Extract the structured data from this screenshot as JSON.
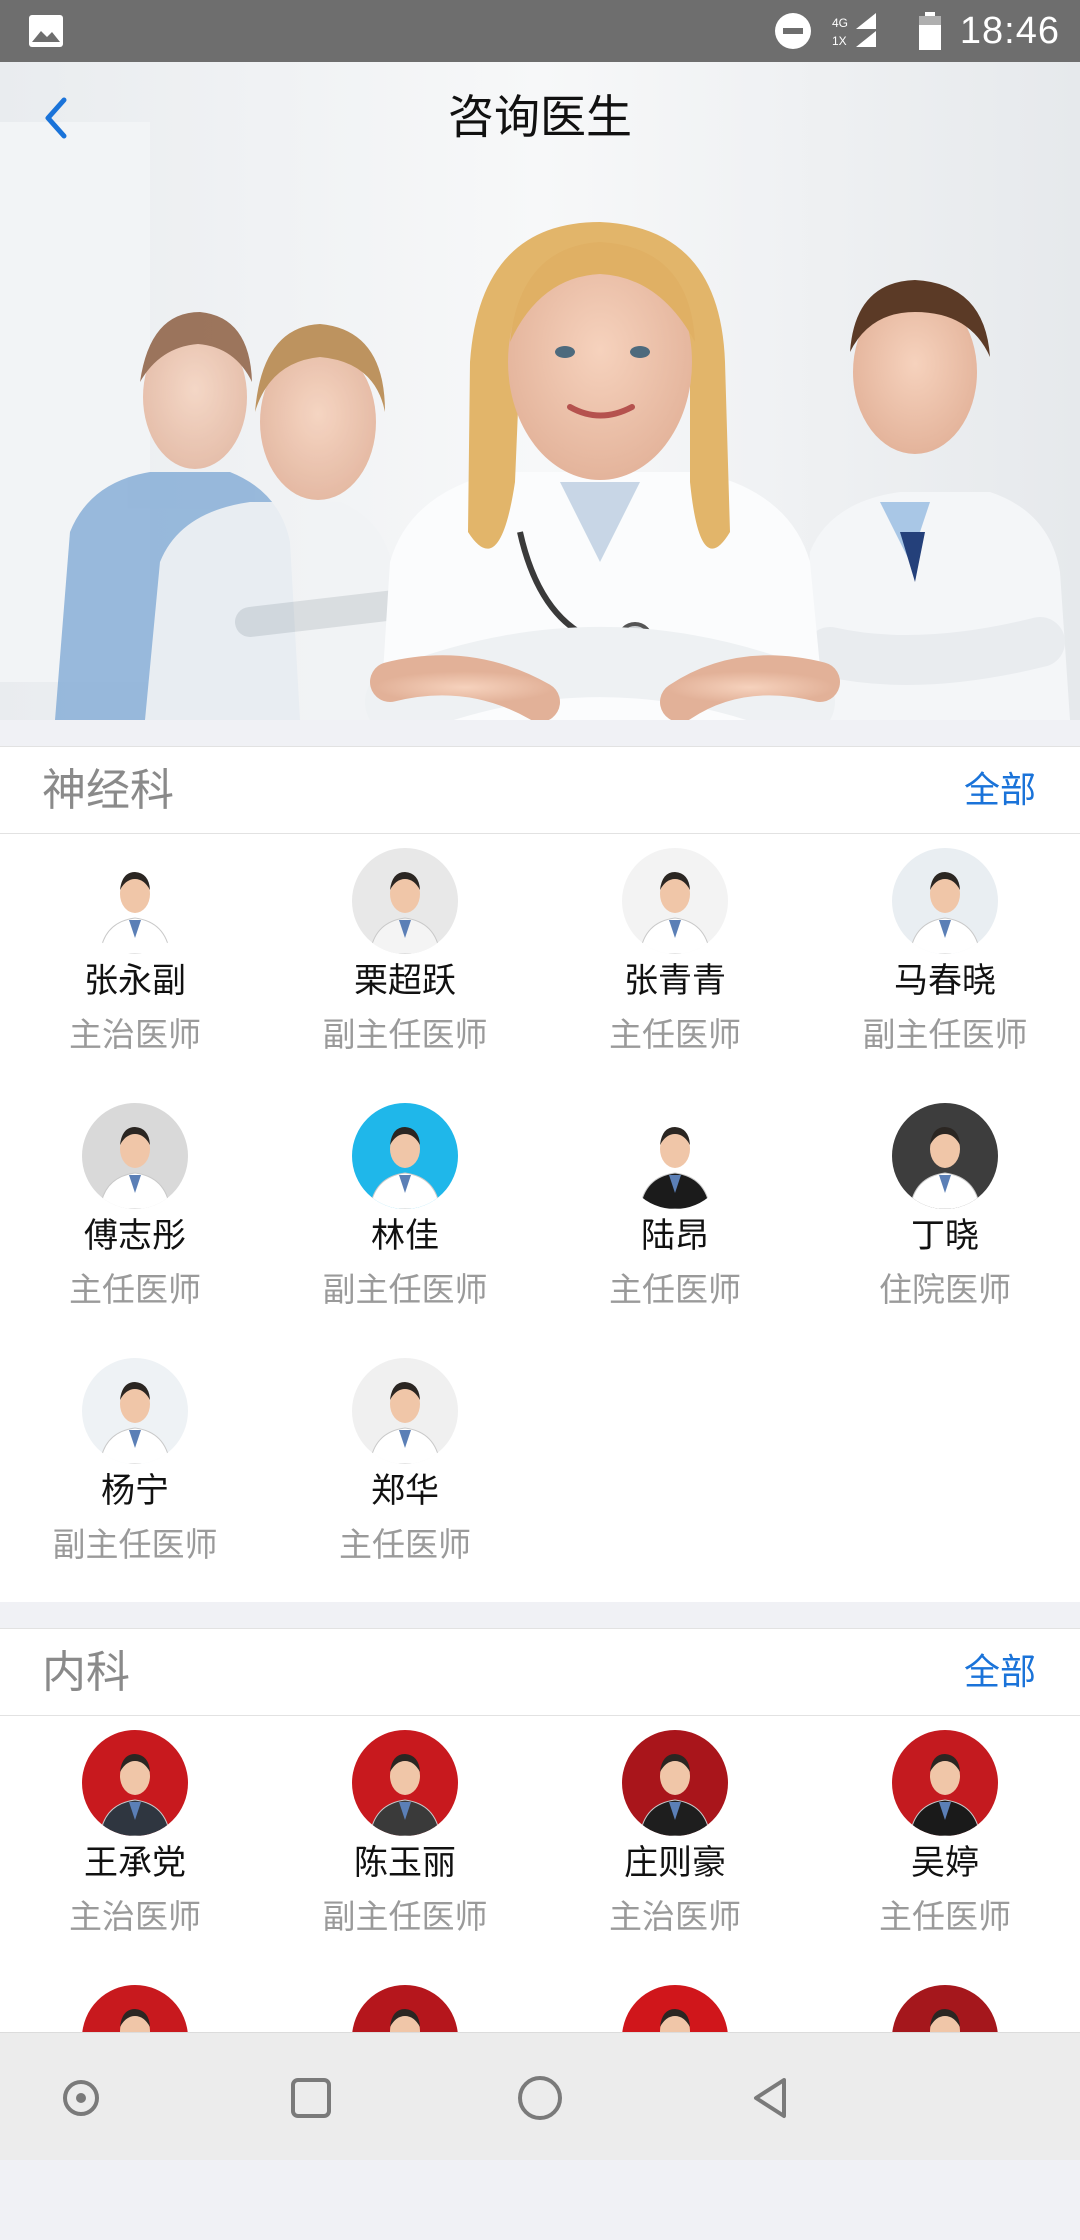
{
  "status_bar": {
    "network": "4G",
    "network_sub": "1X",
    "time": "18:46"
  },
  "header": {
    "title": "咨询医生",
    "back_icon": "chevron-left-icon"
  },
  "sections": [
    {
      "title": "神经科",
      "all_label": "全部",
      "doctors": [
        {
          "name": "张永副",
          "title": "主治医师",
          "bg": "#ffffff",
          "coat": "#ffffff"
        },
        {
          "name": "栗超跃",
          "title": "副主任医师",
          "bg": "#e8e8e8",
          "coat": "#f4f4f4"
        },
        {
          "name": "张青青",
          "title": "主任医师",
          "bg": "#f3f3f3",
          "coat": "#ffffff"
        },
        {
          "name": "马春晓",
          "title": "副主任医师",
          "bg": "#e9eef2",
          "coat": "#ffffff"
        },
        {
          "name": "傅志彤",
          "title": "主任医师",
          "bg": "#d9d9d9",
          "coat": "#ffffff"
        },
        {
          "name": "林佳",
          "title": "副主任医师",
          "bg": "#1fb7ea",
          "coat": "#ffffff"
        },
        {
          "name": "陆昂",
          "title": "主任医师",
          "bg": "#ffffff",
          "coat": "#1b1b1b"
        },
        {
          "name": "丁晓",
          "title": "住院医师",
          "bg": "#3d3d3d",
          "coat": "#ffffff"
        },
        {
          "name": "杨宁",
          "title": "副主任医师",
          "bg": "#eef2f5",
          "coat": "#ffffff"
        },
        {
          "name": "郑华",
          "title": "主任医师",
          "bg": "#f0f0f0",
          "coat": "#ffffff"
        }
      ]
    },
    {
      "title": "内科",
      "all_label": "全部",
      "doctors": [
        {
          "name": "王承党",
          "title": "主治医师",
          "bg": "#c8191e",
          "coat": "#2f3640"
        },
        {
          "name": "陈玉丽",
          "title": "副主任医师",
          "bg": "#c8191e",
          "coat": "#3a3a3a"
        },
        {
          "name": "庄则豪",
          "title": "主治医师",
          "bg": "#a9151b",
          "coat": "#1e1e1e"
        },
        {
          "name": "吴婷",
          "title": "主任医师",
          "bg": "#c41a1f",
          "coat": "#1a1a1a"
        }
      ],
      "partial_row_bg": [
        "#c8191e",
        "#b5161c",
        "#d0161b",
        "#a5171c"
      ]
    }
  ],
  "nav_bar": {
    "icons": [
      "circle-dot-icon",
      "recents-square-icon",
      "home-circle-icon",
      "back-triangle-icon"
    ]
  },
  "colors": {
    "accent": "#1a73d9",
    "status_bar": "#6e6e6e",
    "section_title": "#8a8a8a",
    "doctor_title": "#9a9a9a"
  }
}
